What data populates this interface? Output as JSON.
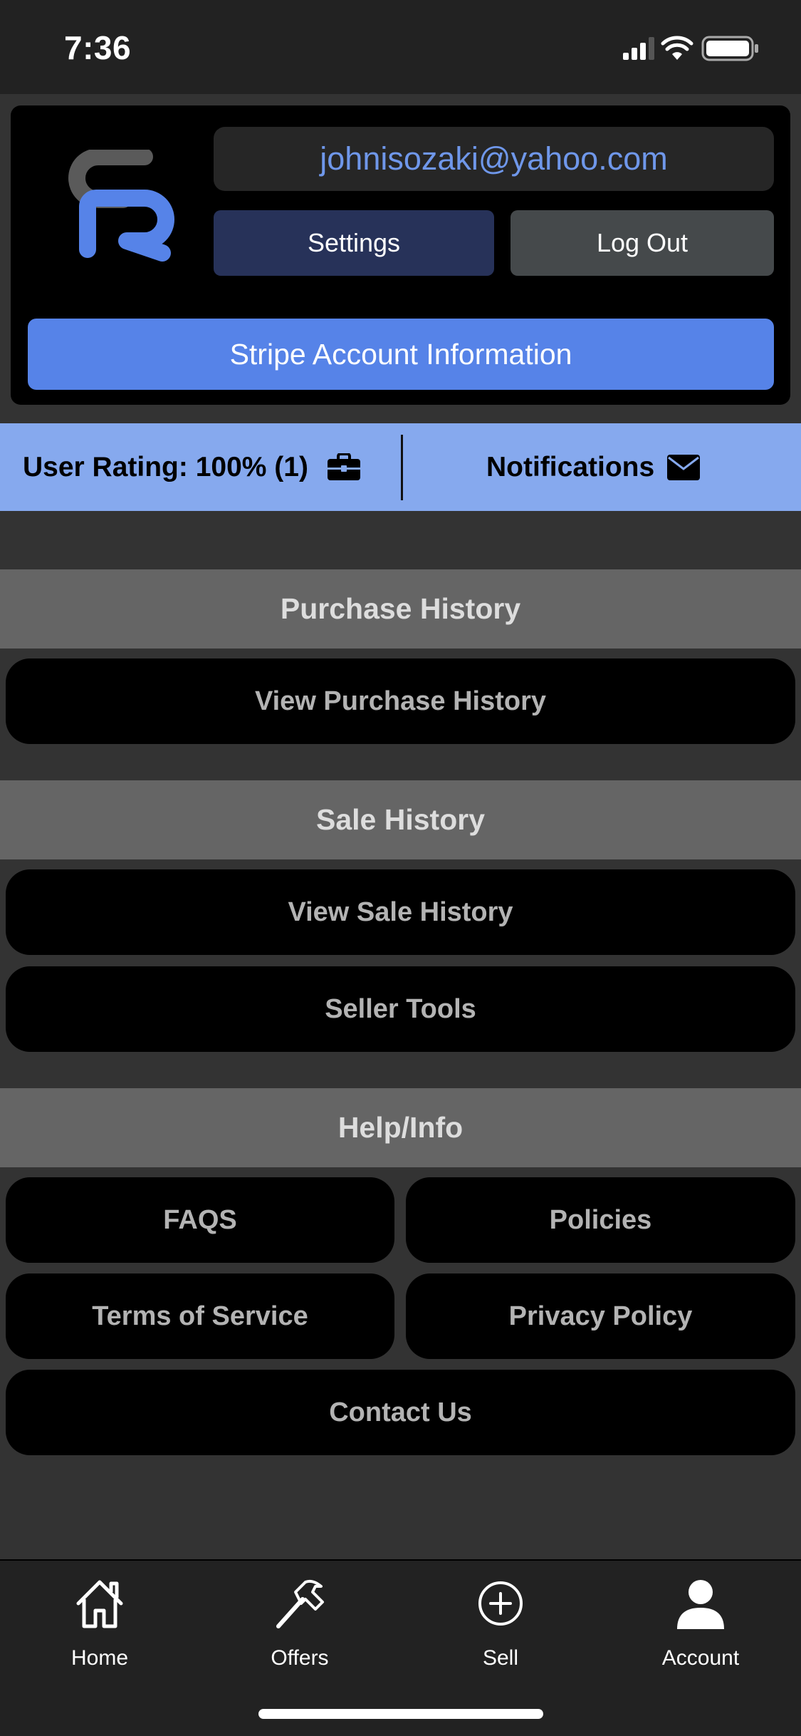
{
  "status_bar": {
    "time": "7:36"
  },
  "account": {
    "email": "johnisozaki@yahoo.com",
    "settings_label": "Settings",
    "logout_label": "Log Out",
    "stripe_label": "Stripe Account Information"
  },
  "rating_bar": {
    "rating_text": "User Rating: 100% (1)",
    "notifications_label": "Notifications"
  },
  "sections": {
    "purchase": {
      "title": "Purchase History",
      "view_label": "View Purchase History"
    },
    "sale": {
      "title": "Sale History",
      "view_label": "View Sale History",
      "tools_label": "Seller Tools"
    },
    "help": {
      "title": "Help/Info",
      "faqs": "FAQS",
      "policies": "Policies",
      "terms": "Terms of Service",
      "privacy": "Privacy Policy",
      "contact": "Contact Us"
    }
  },
  "tab_bar": {
    "items": [
      {
        "label": "Home",
        "icon": "home-icon"
      },
      {
        "label": "Offers",
        "icon": "hammer-icon"
      },
      {
        "label": "Sell",
        "icon": "plus-circle-icon"
      },
      {
        "label": "Account",
        "icon": "person-icon"
      }
    ]
  },
  "colors": {
    "accent": "#5683e8",
    "rating_bar": "#86a9ee",
    "email_text": "#6f97ea",
    "settings_button": "#273259",
    "logout_button": "#45494b"
  }
}
